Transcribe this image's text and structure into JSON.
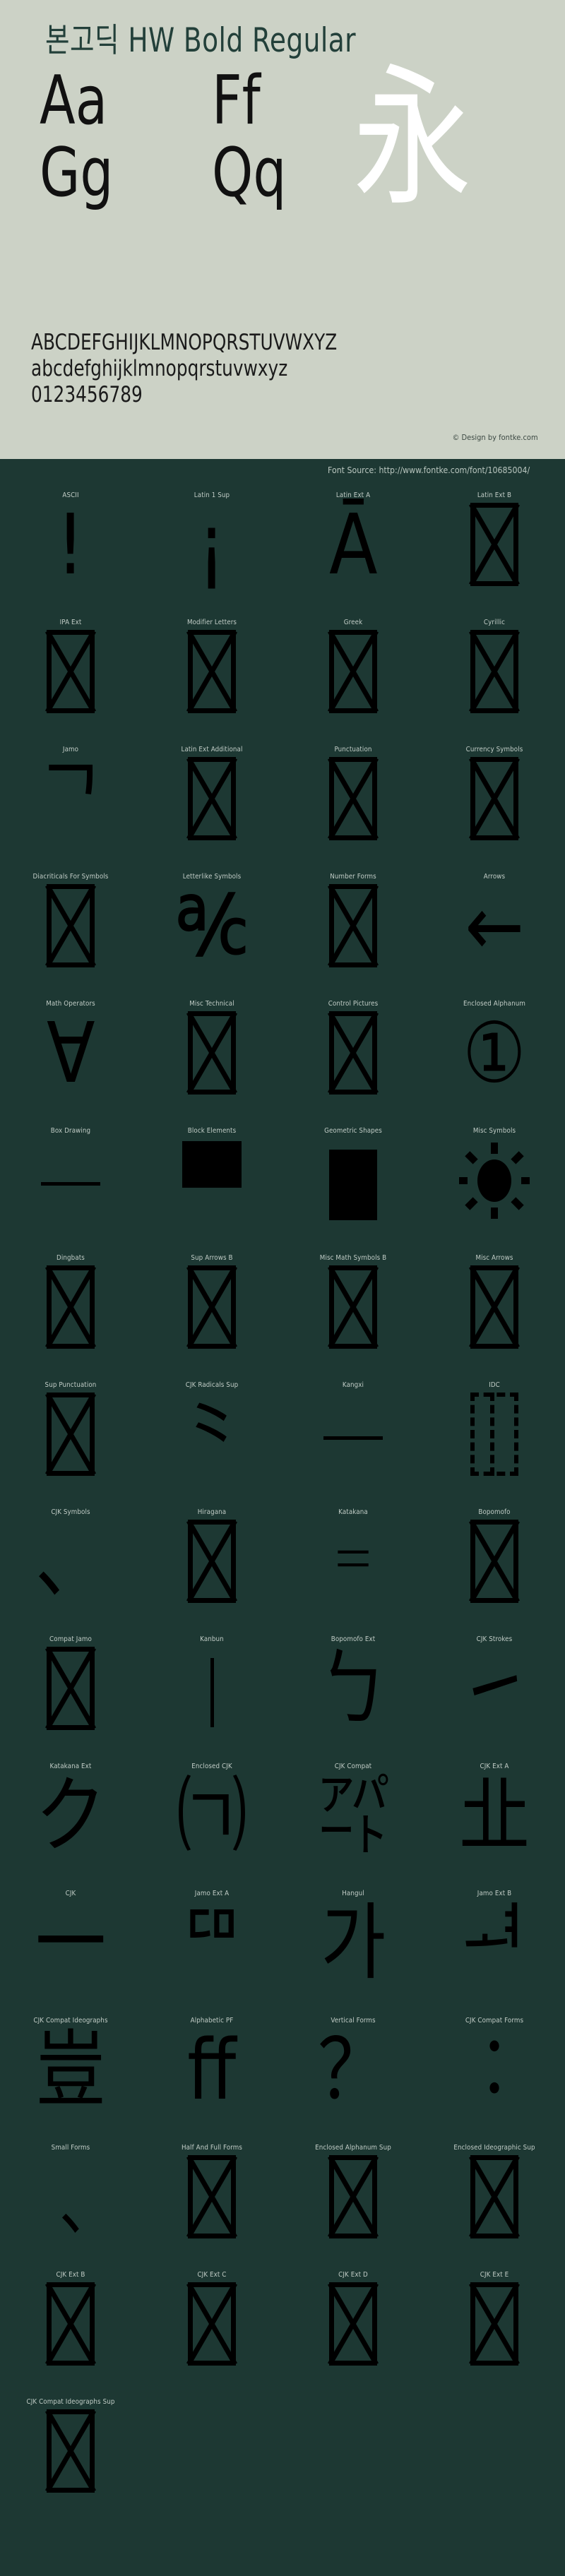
{
  "hero": {
    "title": "본고딕 HW Bold Regular",
    "sample_letters": [
      "Aa",
      "Ff",
      "Gg",
      "Qq"
    ],
    "cjk_sample": "永",
    "specimen_lines": [
      "ABCDEFGHIJKLMNOPQRSTUVWXYZ",
      "abcdefghijklmnopqrstuvwxyz",
      "0123456789"
    ],
    "credit": "© Design by fontke.com"
  },
  "source_bar": {
    "text": "Font Source: http://www.fontke.com/font/10685004/"
  },
  "colors": {
    "panel_bg": "#ccd2c6",
    "dark_bg": "#1d3833",
    "label": "#c2cdc7",
    "title": "#23403a",
    "glyph": "#000000",
    "white_glyph": "#ffffff"
  },
  "blocks": [
    {
      "label": "ASCII",
      "glyph": "!",
      "kind": "text"
    },
    {
      "label": "Latin 1 Sup",
      "glyph": "¡",
      "kind": "text"
    },
    {
      "label": "Latin Ext A",
      "glyph": "Ā",
      "kind": "text"
    },
    {
      "label": "Latin Ext B",
      "glyph": "",
      "kind": "tofu"
    },
    {
      "label": "IPA Ext",
      "glyph": "",
      "kind": "tofu"
    },
    {
      "label": "Modifier Letters",
      "glyph": "",
      "kind": "tofu"
    },
    {
      "label": "Greek",
      "glyph": "",
      "kind": "tofu"
    },
    {
      "label": "Cyrillic",
      "glyph": "",
      "kind": "tofu"
    },
    {
      "label": "Jamo",
      "glyph": "ᄀ",
      "kind": "text"
    },
    {
      "label": "Latin Ext Additional",
      "glyph": "",
      "kind": "tofu"
    },
    {
      "label": "Punctuation",
      "glyph": "",
      "kind": "tofu"
    },
    {
      "label": "Currency Symbols",
      "glyph": "",
      "kind": "tofu"
    },
    {
      "label": "Diacriticals For Symbols",
      "glyph": "",
      "kind": "tofu"
    },
    {
      "label": "Letterlike Symbols",
      "glyph": "℀",
      "kind": "text"
    },
    {
      "label": "Number Forms",
      "glyph": "",
      "kind": "tofu"
    },
    {
      "label": "Arrows",
      "glyph": "←",
      "kind": "text"
    },
    {
      "label": "Math Operators",
      "glyph": "∀",
      "kind": "text"
    },
    {
      "label": "Misc Technical",
      "glyph": "",
      "kind": "tofu"
    },
    {
      "label": "Control Pictures",
      "glyph": "",
      "kind": "tofu"
    },
    {
      "label": "Enclosed Alphanum",
      "glyph": "①",
      "kind": "text"
    },
    {
      "label": "Box Drawing",
      "glyph": "─",
      "kind": "hline"
    },
    {
      "label": "Block Elements",
      "glyph": "█",
      "kind": "block"
    },
    {
      "label": "Geometric Shapes",
      "glyph": "▮",
      "kind": "rect"
    },
    {
      "label": "Misc Symbols",
      "glyph": "☀",
      "kind": "sun"
    },
    {
      "label": "Dingbats",
      "glyph": "",
      "kind": "tofu"
    },
    {
      "label": "Sup Arrows B",
      "glyph": "",
      "kind": "tofu"
    },
    {
      "label": "Misc Math Symbols B",
      "glyph": "",
      "kind": "tofu"
    },
    {
      "label": "Misc Arrows",
      "glyph": "",
      "kind": "tofu"
    },
    {
      "label": "Sup Punctuation",
      "glyph": "",
      "kind": "tofu"
    },
    {
      "label": "CJK Radicals Sup",
      "glyph": "⺀",
      "kind": "text"
    },
    {
      "label": "Kangxi",
      "glyph": "⼀",
      "kind": "hline"
    },
    {
      "label": "IDC",
      "glyph": "⿰",
      "kind": "tofu-dashed"
    },
    {
      "label": "CJK Symbols",
      "glyph": "、",
      "kind": "text"
    },
    {
      "label": "Hiragana",
      "glyph": "",
      "kind": "tofu"
    },
    {
      "label": "Katakana",
      "glyph": "゠",
      "kind": "text"
    },
    {
      "label": "Bopomofo",
      "glyph": "",
      "kind": "tofu"
    },
    {
      "label": "Compat Jamo",
      "glyph": "",
      "kind": "tofu"
    },
    {
      "label": "Kanbun",
      "glyph": "㆐",
      "kind": "vline"
    },
    {
      "label": "Bopomofo Ext",
      "glyph": "ㄅ",
      "kind": "text"
    },
    {
      "label": "CJK Strokes",
      "glyph": "㇀",
      "kind": "text"
    },
    {
      "label": "Katakana Ext",
      "glyph": "ク",
      "kind": "text"
    },
    {
      "label": "Enclosed CJK",
      "glyph": "㈀",
      "kind": "text"
    },
    {
      "label": "CJK Compat",
      "glyph": "㌀",
      "kind": "text"
    },
    {
      "label": "CJK Ext A",
      "glyph": "㐀",
      "kind": "text"
    },
    {
      "label": "CJK",
      "glyph": "一",
      "kind": "text"
    },
    {
      "label": "Jamo Ext A",
      "glyph": "ꥠ",
      "kind": "text"
    },
    {
      "label": "Hangul",
      "glyph": "가",
      "kind": "text"
    },
    {
      "label": "Jamo Ext B",
      "glyph": "ힰ",
      "kind": "text"
    },
    {
      "label": "CJK Compat Ideographs",
      "glyph": "豈",
      "kind": "text"
    },
    {
      "label": "Alphabetic PF",
      "glyph": "ﬀ",
      "kind": "text"
    },
    {
      "label": "Vertical Forms",
      "glyph": "？",
      "kind": "text"
    },
    {
      "label": "CJK Compat Forms",
      "glyph": "︰",
      "kind": "text"
    },
    {
      "label": "Small Forms",
      "glyph": "﹑",
      "kind": "text"
    },
    {
      "label": "Half And Full Forms",
      "glyph": "",
      "kind": "tofu"
    },
    {
      "label": "Enclosed Alphanum Sup",
      "glyph": "🄀",
      "kind": "tofu"
    },
    {
      "label": "Enclosed Ideographic Sup",
      "glyph": "🈀",
      "kind": "tofu"
    },
    {
      "label": "CJK Ext B",
      "glyph": "𠀀",
      "kind": "tofu"
    },
    {
      "label": "CJK Ext C",
      "glyph": "𪜀",
      "kind": "tofu"
    },
    {
      "label": "CJK Ext D",
      "glyph": "𫝀",
      "kind": "tofu"
    },
    {
      "label": "CJK Ext E",
      "glyph": "𫠠",
      "kind": "tofu"
    },
    {
      "label": "CJK Compat Ideographs Sup",
      "glyph": "𪎽",
      "kind": "tofu"
    }
  ]
}
